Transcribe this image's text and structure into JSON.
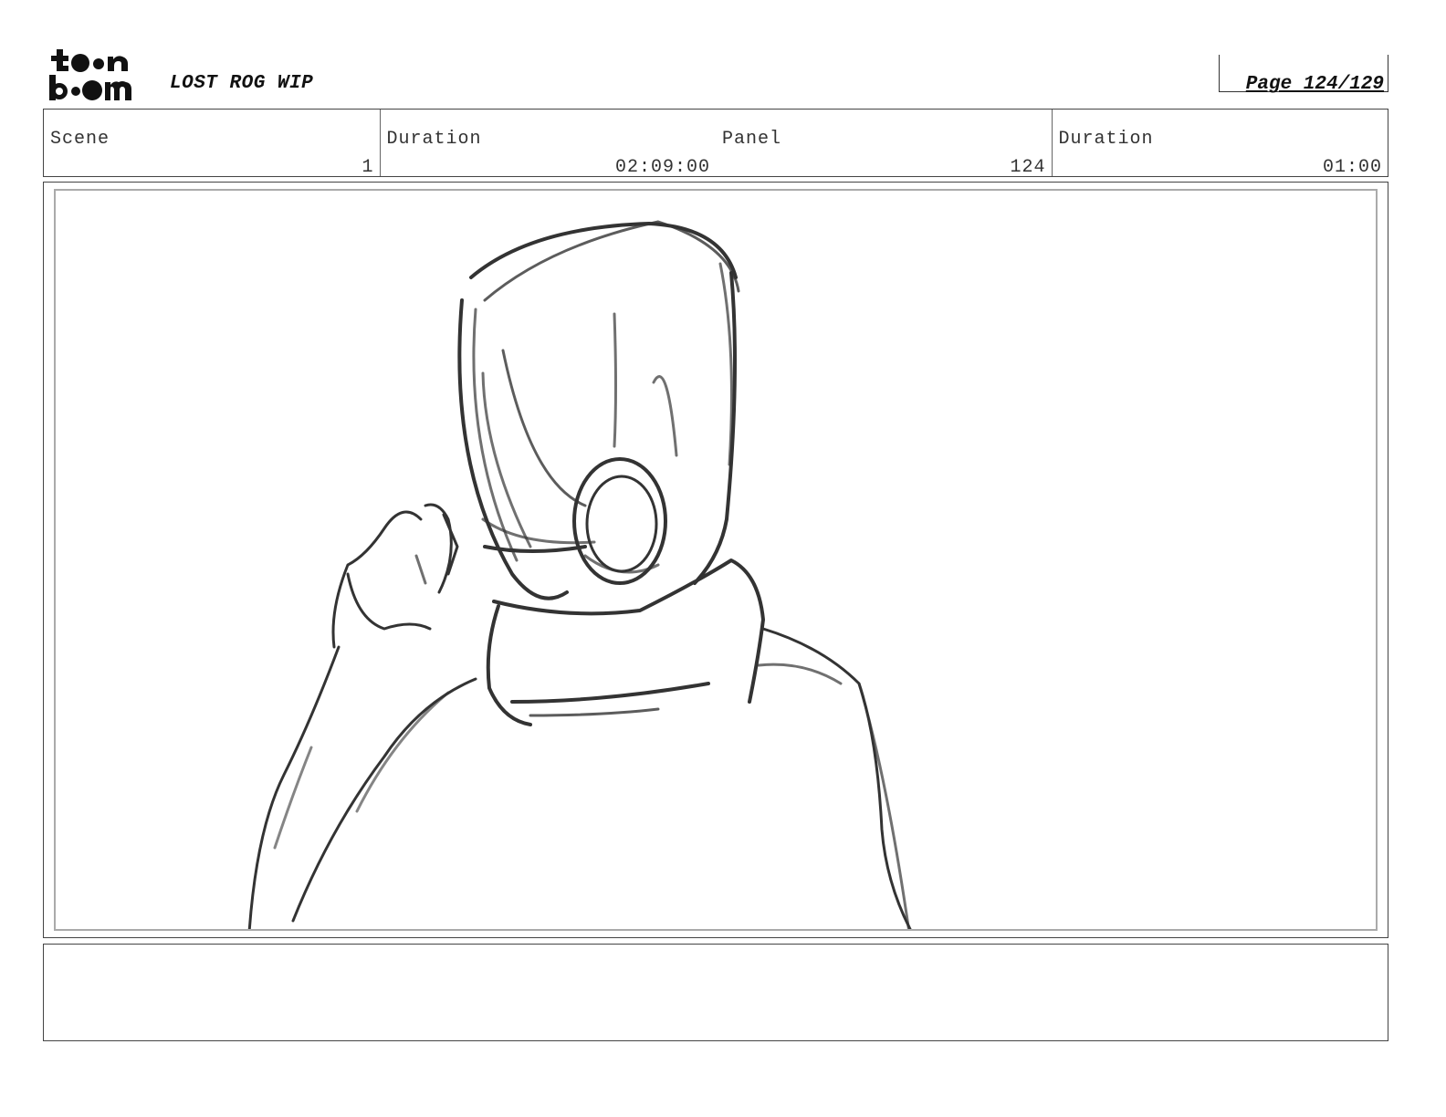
{
  "header": {
    "logo_text_top": "toon",
    "logo_text_bottom": "boom",
    "project_title": "LOST ROG WIP",
    "page_label": "Page 124/129"
  },
  "info": {
    "scene_label": "Scene",
    "scene_value": "1",
    "scene_duration_label": "Duration",
    "scene_duration_value": "02:09:00",
    "panel_label": "Panel",
    "panel_value": "124",
    "panel_duration_label": "Duration",
    "panel_duration_value": "01:00"
  },
  "panel": {
    "sketch_subject": "hazmat-suit-figure-sketch"
  },
  "notes": {
    "text": ""
  }
}
